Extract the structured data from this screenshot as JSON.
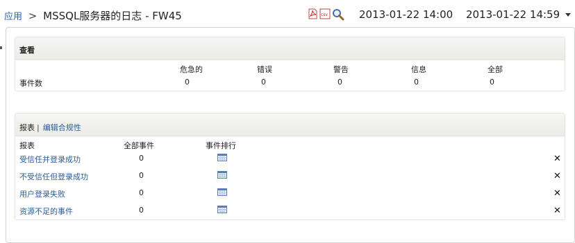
{
  "breadcrumb": {
    "root": "应用",
    "separator": ">",
    "title": "MSSQL服务器的日志 - FW45"
  },
  "toolbar": {
    "icons": [
      "pdf-icon",
      "csv-icon",
      "search-icon"
    ],
    "csv_text": "csv"
  },
  "date_range": {
    "start": "2013-01-22 14:00",
    "end": "2013-01-22 14:59"
  },
  "summary": {
    "title": "查看",
    "columns": [
      "危急的",
      "错误",
      "警告",
      "信息",
      "全部"
    ],
    "row_label": "事件数",
    "values": [
      "0",
      "0",
      "0",
      "0",
      "0"
    ]
  },
  "reports": {
    "link_reports": "报表",
    "link_compliance": "编辑合规性",
    "columns": [
      "报表",
      "全部事件",
      "事件排行"
    ],
    "rows": [
      {
        "name": "受信任并登录成功",
        "count": "0"
      },
      {
        "name": "不受信任但登录成功",
        "count": "0"
      },
      {
        "name": "用户登录失败",
        "count": "0"
      },
      {
        "name": "资源不足的事件",
        "count": "0"
      }
    ],
    "close_symbol": "✕"
  }
}
